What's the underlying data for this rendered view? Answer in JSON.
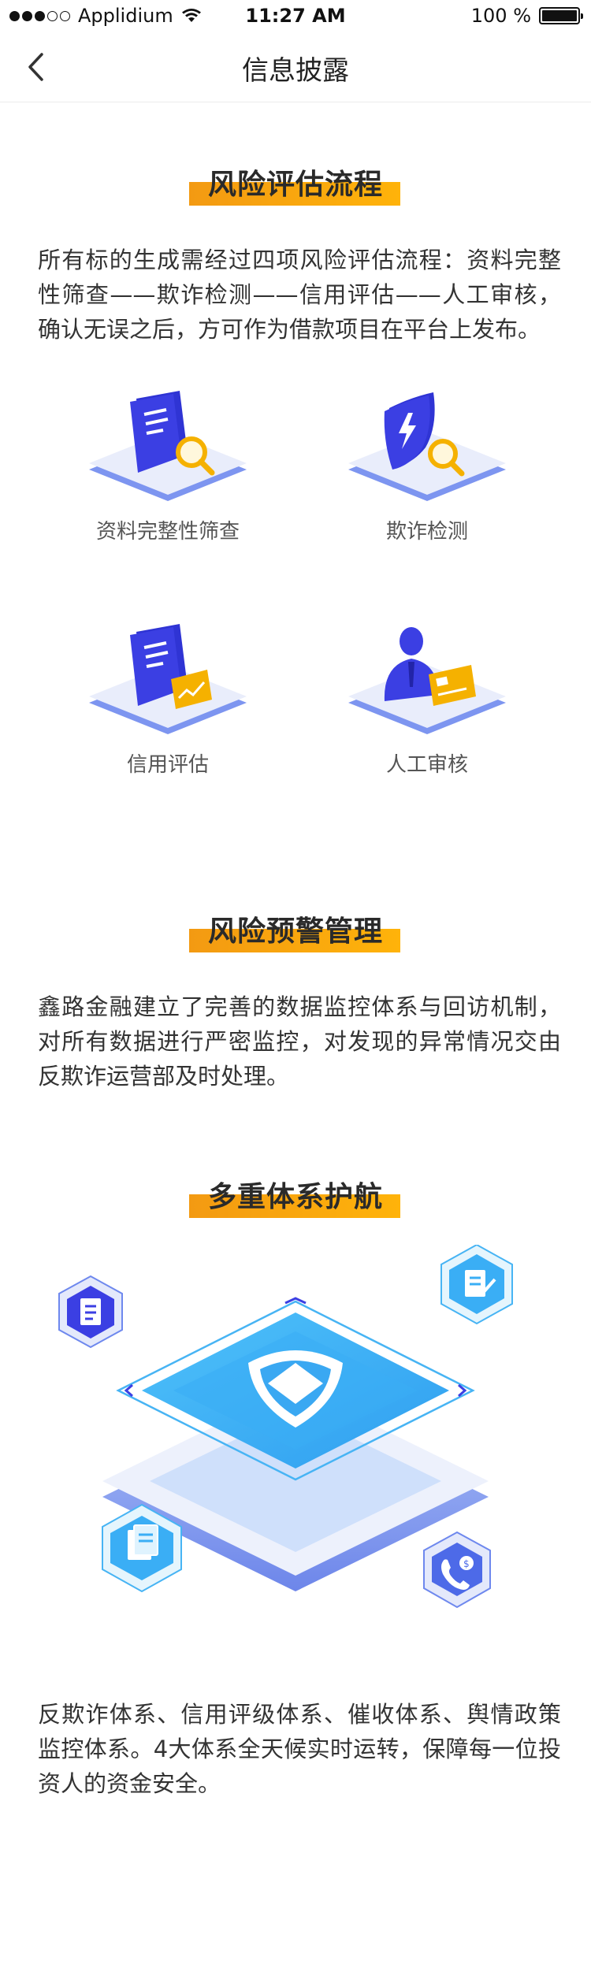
{
  "status_bar": {
    "carrier": "Applidium",
    "time": "11:27 AM",
    "battery": "100 %",
    "battery_level": 1.0
  },
  "nav": {
    "title": "信息披露",
    "back_icon": "chevron-left-icon"
  },
  "sections": {
    "risk_assessment": {
      "heading": "风险评估流程",
      "text": "所有标的生成需经过四项风险评估流程：资料完整性筛查——欺诈检测——信用评估——人工审核，确认无误之后，方可作为借款项目在平台上发布。",
      "items": [
        {
          "label": "资料完整性筛查",
          "icon": "document-magnifier-icon"
        },
        {
          "label": "欺诈检测",
          "icon": "shield-magnifier-icon"
        },
        {
          "label": "信用评估",
          "icon": "document-card-icon"
        },
        {
          "label": "人工审核",
          "icon": "person-card-icon"
        }
      ]
    },
    "risk_warning": {
      "heading": "风险预警管理",
      "text": "鑫路金融建立了完善的数据监控体系与回访机制，对所有数据进行严密监控，对发现的异常情况交由反欺诈运营部及时处理。"
    },
    "multi_system": {
      "heading": "多重体系护航",
      "text": "反欺诈体系、信用评级体系、催收体系、舆情政策监控体系。4大体系全天候实时运转，保障每一位投资人的资金安全。",
      "illustration_icons": [
        "checklist-icon",
        "edit-document-icon",
        "documents-icon",
        "phone-payment-icon",
        "shield-icon"
      ]
    }
  },
  "colors": {
    "accent_orange": "#f5a00e",
    "primary_blue": "#3a3ee0",
    "light_blue": "#44b4f5",
    "platform": "#e8ecfb"
  }
}
